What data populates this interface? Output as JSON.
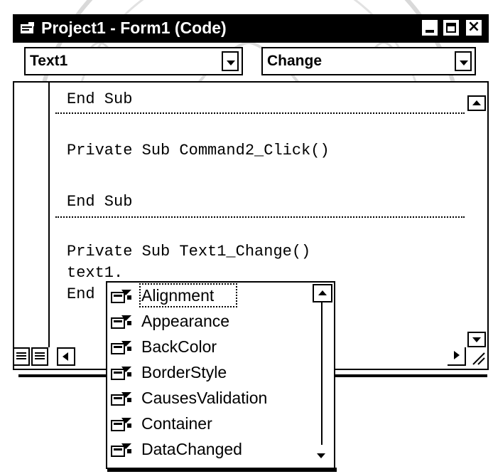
{
  "window": {
    "title": "Project1 - Form1 (Code)",
    "close_glyph": "×"
  },
  "object_combo": {
    "value": "Text1"
  },
  "procedure_combo": {
    "value": "Change"
  },
  "code": {
    "lines": [
      "End Sub",
      "Private Sub Command2_Click()",
      "End Sub",
      "Private Sub Text1_Change()",
      "text1.",
      "End"
    ]
  },
  "autocomplete": {
    "items": [
      {
        "label": "Alignment",
        "icon": "property-icon",
        "selected": true
      },
      {
        "label": "Appearance",
        "icon": "property-icon"
      },
      {
        "label": "BackColor",
        "icon": "property-icon"
      },
      {
        "label": "BorderStyle",
        "icon": "property-icon"
      },
      {
        "label": "CausesValidation",
        "icon": "property-icon"
      },
      {
        "label": "Container",
        "icon": "property-icon"
      },
      {
        "label": "DataChanged",
        "icon": "property-icon"
      }
    ]
  },
  "colors": {
    "titlebar": "#000000",
    "text": "#000000",
    "background": "#ffffff"
  }
}
